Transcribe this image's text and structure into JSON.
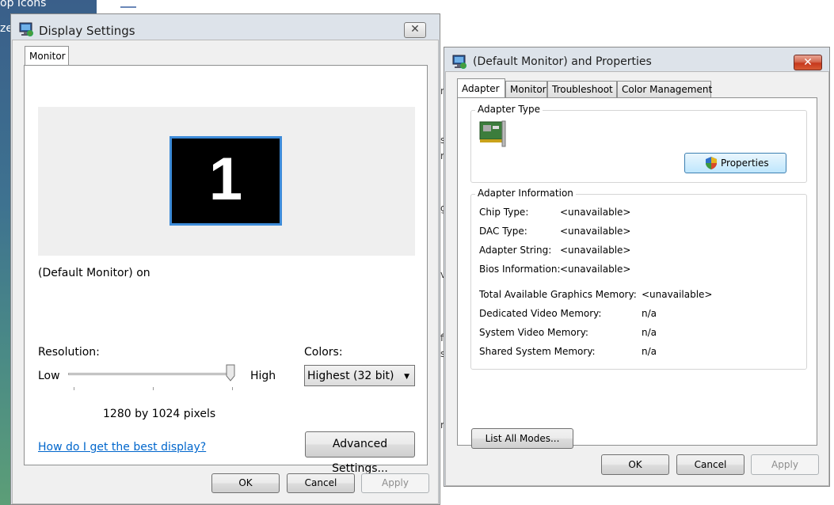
{
  "desktop": {
    "label_top": "op Icons",
    "label_mid": "ze"
  },
  "display_settings": {
    "title": "Display Settings",
    "tab": "Monitor",
    "monitor_number": "1",
    "monitor_caption": "(Default Monitor) on",
    "resolution_label": "Resolution:",
    "low_label": "Low",
    "high_label": "High",
    "resolution_value": "1280 by 1024 pixels",
    "colors_label": "Colors:",
    "colors_value": "Highest (32 bit)",
    "help_link": "How do I get the best display?",
    "advanced_button": "Advanced Settings...",
    "ok_button": "OK",
    "cancel_button": "Cancel",
    "apply_button": "Apply"
  },
  "properties": {
    "title": "(Default Monitor) and  Properties",
    "tabs": [
      "Adapter",
      "Monitor",
      "Troubleshoot",
      "Color Management"
    ],
    "adapter_type_group": "Adapter Type",
    "properties_button": "Properties",
    "adapter_info_group": "Adapter Information",
    "info": [
      {
        "label": "Chip Type:",
        "value": "<unavailable>"
      },
      {
        "label": "DAC Type:",
        "value": "<unavailable>"
      },
      {
        "label": "Adapter String:",
        "value": "<unavailable>"
      },
      {
        "label": "Bios Information:",
        "value": "<unavailable>"
      }
    ],
    "memory": [
      {
        "label": "Total Available Graphics Memory:",
        "value": "<unavailable>"
      },
      {
        "label": "Dedicated Video Memory:",
        "value": "n/a"
      },
      {
        "label": "System Video Memory:",
        "value": "n/a"
      },
      {
        "label": "Shared System Memory:",
        "value": "n/a"
      }
    ],
    "list_modes_button": "List All Modes...",
    "ok_button": "OK",
    "cancel_button": "Cancel",
    "apply_button": "Apply"
  },
  "background_window": {
    "fragments": [
      "n",
      "s",
      "r",
      "g",
      "v",
      "f",
      "s",
      "r"
    ]
  }
}
